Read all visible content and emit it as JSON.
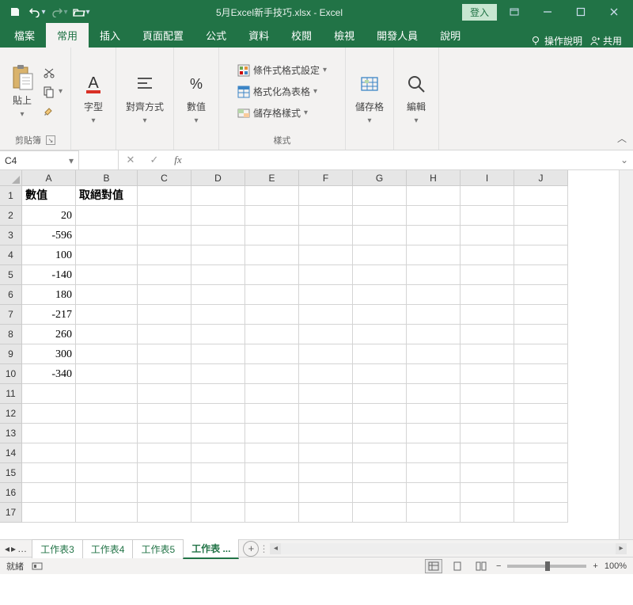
{
  "titlebar": {
    "filename": "5月Excel新手技巧.xlsx - Excel",
    "login": "登入"
  },
  "tabs": {
    "file": "檔案",
    "home": "常用",
    "insert": "插入",
    "layout": "頁面配置",
    "formulas": "公式",
    "data": "資料",
    "review": "校閱",
    "view": "檢視",
    "developer": "開發人員",
    "help": "說明",
    "tellme": "操作說明",
    "share": "共用"
  },
  "ribbon": {
    "clipboard": {
      "paste": "貼上",
      "label": "剪貼簿"
    },
    "font": {
      "label": "字型"
    },
    "align": {
      "label": "對齊方式"
    },
    "number": {
      "label": "數值"
    },
    "styles": {
      "conditional": "條件式格式設定",
      "table": "格式化為表格",
      "cellstyles": "儲存格樣式",
      "label": "樣式"
    },
    "cells": {
      "label": "儲存格"
    },
    "editing": {
      "label": "編輯"
    }
  },
  "namebox": "C4",
  "columns": [
    "A",
    "B",
    "C",
    "D",
    "E",
    "F",
    "G",
    "H",
    "I",
    "J"
  ],
  "rows": [
    "1",
    "2",
    "3",
    "4",
    "5",
    "6",
    "7",
    "8",
    "9",
    "10",
    "11",
    "12",
    "13",
    "14",
    "15",
    "16",
    "17"
  ],
  "headers": {
    "a1": "數值",
    "b1": "取絕對值"
  },
  "data_a": [
    "20",
    "-596",
    "100",
    "-140",
    "180",
    "-217",
    "260",
    "300",
    "-340"
  ],
  "sheets": {
    "s3": "工作表3",
    "s4": "工作表4",
    "s5": "工作表5",
    "s6": "工作表 ..."
  },
  "status": {
    "ready": "就緒",
    "zoom": "100%"
  }
}
